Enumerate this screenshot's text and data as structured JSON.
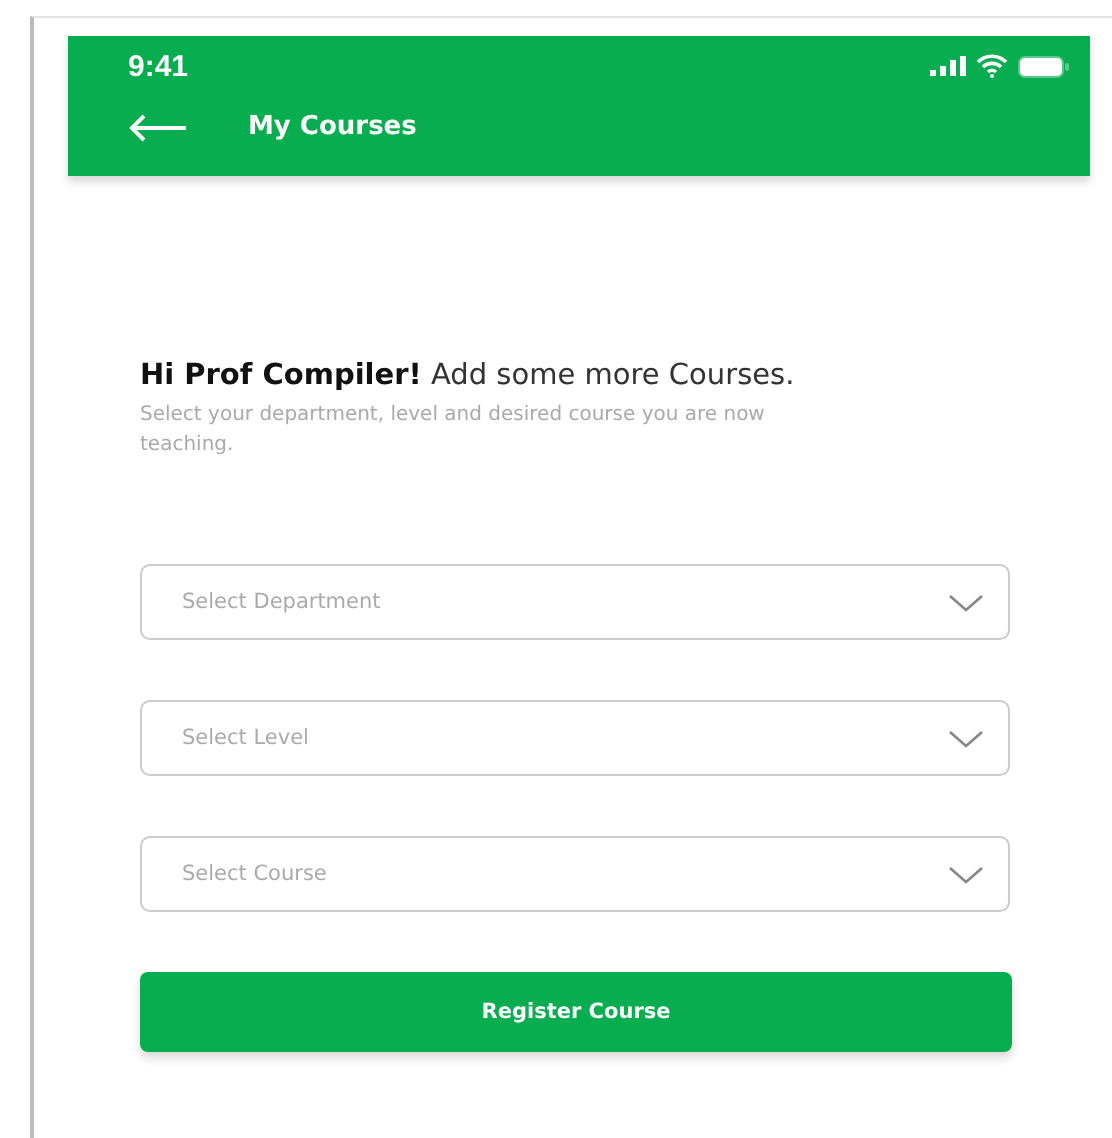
{
  "status_bar": {
    "time": "9:41"
  },
  "app_bar": {
    "title": "My Courses"
  },
  "greeting": {
    "text": "**Hi Prof Compiler!** Add some more Courses.",
    "subtitle": "Select your department, level and desired course you are now teaching."
  },
  "selects": [
    {
      "placeholder": "Select Department"
    },
    {
      "placeholder": "Select Level"
    },
    {
      "placeholder": "Select Course"
    }
  ],
  "buttons": [
    "Register Course"
  ]
}
